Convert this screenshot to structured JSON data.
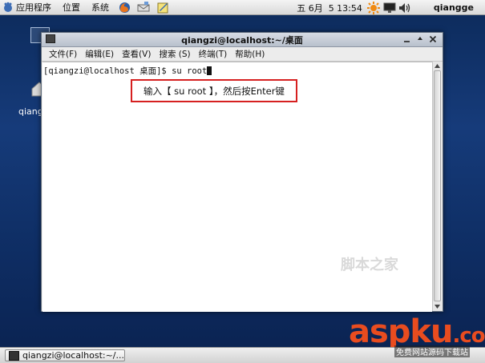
{
  "top_panel": {
    "menus": [
      "应用程序",
      "位置",
      "系统"
    ],
    "clock": "五 6月  5 13:54",
    "user": "qiangge"
  },
  "desktop": {
    "partial_label": "qiang:"
  },
  "window": {
    "title": "qiangzi@localhost:~/桌面",
    "menus": [
      "文件(F)",
      "编辑(E)",
      "查看(V)",
      "搜索 (S)",
      "终端(T)",
      "帮助(H)"
    ],
    "prompt": "[qiangzi@localhost 桌面]$ ",
    "command": "su root"
  },
  "annotation": {
    "text": "输入【 su root 】，然后按Enter键"
  },
  "taskbar": {
    "window_button": "qiangzi@localhost:~/..."
  },
  "watermark": {
    "text": "脚本之家"
  },
  "brand": {
    "logo": "aspku",
    "suffix": ".com",
    "tagline": "免费网站源码下载站"
  },
  "colors": {
    "accent_red": "#d62020",
    "brand_orange": "#e94c1f",
    "brand_yellow": "#f4a21d"
  }
}
